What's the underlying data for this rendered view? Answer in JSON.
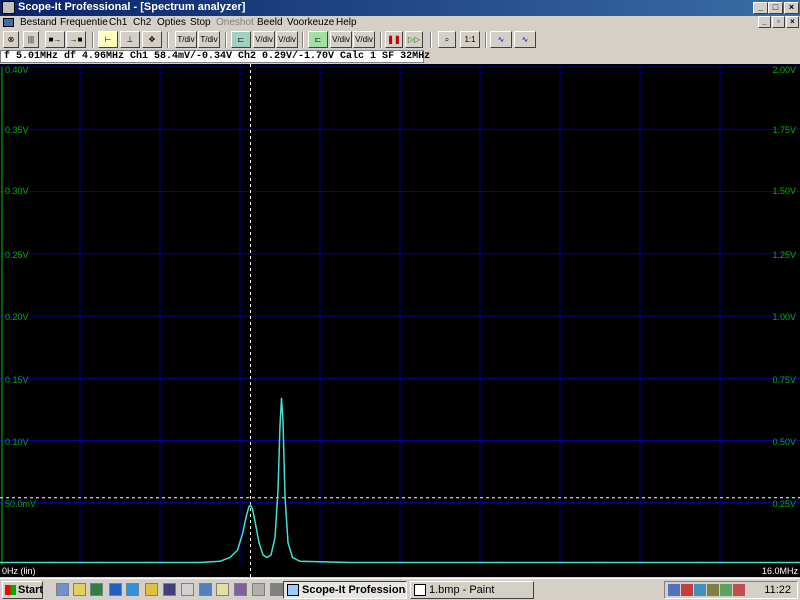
{
  "window": {
    "title": "Scope-It Professional - [Spectrum analyzer]"
  },
  "menu": {
    "items": [
      {
        "label": "Bestand",
        "enabled": true
      },
      {
        "label": "Frequentie",
        "enabled": true
      },
      {
        "label": "Ch1",
        "enabled": true
      },
      {
        "label": "Ch2",
        "enabled": true
      },
      {
        "label": "Opties",
        "enabled": true
      },
      {
        "label": "Stop",
        "enabled": true
      },
      {
        "label": "Oneshot",
        "enabled": false
      },
      {
        "label": "Beeld",
        "enabled": true
      },
      {
        "label": "Voorkeuze",
        "enabled": true
      },
      {
        "label": "Help",
        "enabled": true
      }
    ]
  },
  "toolbar": {
    "buttons": [
      {
        "icon": "record-icon",
        "glyph": "⊗"
      },
      {
        "icon": "bars-icon",
        "glyph": "|||"
      },
      {
        "icon": "ch1-arrow-icon",
        "glyph": "■→"
      },
      {
        "icon": "ch2-arrow-icon",
        "glyph": "→■"
      },
      {
        "icon": "cursor-left-icon",
        "glyph": "⊢"
      },
      {
        "icon": "cursor-mid-icon",
        "glyph": "⊥"
      },
      {
        "icon": "cursor-both-icon",
        "glyph": "✥"
      },
      {
        "icon": "time-per-div-down-icon",
        "glyph": "T/div"
      },
      {
        "icon": "time-per-div-up-icon",
        "glyph": "T/div"
      },
      {
        "icon": "ch1-position-icon",
        "glyph": "⊏"
      },
      {
        "icon": "ch1-volt-div-down-icon",
        "glyph": "V/div"
      },
      {
        "icon": "ch1-volt-div-up-icon",
        "glyph": "V/div"
      },
      {
        "icon": "ch2-position-icon",
        "glyph": "⊏"
      },
      {
        "icon": "ch2-volt-div-down-icon",
        "glyph": "V/div"
      },
      {
        "icon": "ch2-volt-div-up-icon",
        "glyph": "V/div"
      },
      {
        "icon": "pause-icon",
        "glyph": "❚❚"
      },
      {
        "icon": "play-icon",
        "glyph": "▷▷"
      },
      {
        "icon": "zoom-icon",
        "glyph": "⌕"
      },
      {
        "icon": "one-to-one-icon",
        "glyph": "1:1"
      },
      {
        "icon": "waveform-a-icon",
        "glyph": "∿"
      },
      {
        "icon": "waveform-b-icon",
        "glyph": "∿"
      }
    ]
  },
  "status": {
    "text": "f  5.01MHz df  4.96MHz Ch1   58.4mV/-0.34V Ch2   0.29V/-1.70V Calc   1 SF   32MHz"
  },
  "scope": {
    "left_axis": [
      "0.40V",
      "0.35V",
      "0.30V",
      "0.25V",
      "0.20V",
      "0.15V",
      "0.10V",
      "50.0mV"
    ],
    "right_axis": [
      "2.00V",
      "1.75V",
      "1.50V",
      "1.25V",
      "1.00V",
      "0.75V",
      "0.50V",
      "0.25V"
    ],
    "x_start": "0Hz (lin)",
    "x_end": "16.0MHz",
    "colors": {
      "background": "#000000",
      "grid": "#0000a0",
      "ch1_trace": "#40e0d0",
      "ch2_marker": "#00c000",
      "cursor": "#ffffff"
    }
  },
  "chart_data": {
    "type": "line",
    "xlabel": "",
    "ylabel": "",
    "x_range_mhz": [
      0,
      16
    ],
    "y_range_v": [
      0,
      0.4
    ],
    "cursor_frequency_mhz": 5.01,
    "cursor_level_v": 0.054,
    "series": [
      {
        "name": "Ch1",
        "points": [
          [
            0.0,
            0.002
          ],
          [
            0.5,
            0.002
          ],
          [
            1.0,
            0.002
          ],
          [
            2.0,
            0.002
          ],
          [
            3.0,
            0.002
          ],
          [
            4.0,
            0.002
          ],
          [
            4.4,
            0.003
          ],
          [
            4.6,
            0.006
          ],
          [
            4.75,
            0.012
          ],
          [
            4.85,
            0.025
          ],
          [
            4.93,
            0.04
          ],
          [
            4.98,
            0.047
          ],
          [
            5.01,
            0.048
          ],
          [
            5.05,
            0.045
          ],
          [
            5.1,
            0.035
          ],
          [
            5.18,
            0.018
          ],
          [
            5.26,
            0.008
          ],
          [
            5.34,
            0.006
          ],
          [
            5.42,
            0.008
          ],
          [
            5.5,
            0.022
          ],
          [
            5.56,
            0.06
          ],
          [
            5.6,
            0.112
          ],
          [
            5.63,
            0.134
          ],
          [
            5.66,
            0.115
          ],
          [
            5.7,
            0.055
          ],
          [
            5.76,
            0.018
          ],
          [
            5.85,
            0.006
          ],
          [
            6.0,
            0.003
          ],
          [
            7.0,
            0.002
          ],
          [
            8.0,
            0.002
          ],
          [
            10.0,
            0.002
          ],
          [
            12.0,
            0.002
          ],
          [
            14.0,
            0.002
          ],
          [
            16.0,
            0.002
          ]
        ]
      }
    ]
  },
  "taskbar": {
    "start_label": "Start",
    "quick_launch": [
      "save-icon",
      "email-icon",
      "desktop-icon",
      "ie-icon",
      "globe-icon",
      "media-icon",
      "folder-icon",
      "paint-icon",
      "user-icon",
      "docs-icon",
      "tools-icon",
      "settings-icon",
      "arrow-icon"
    ],
    "tasks": [
      {
        "label": "Scope-It Professional...",
        "active": true
      },
      {
        "label": "1.bmp - Paint",
        "active": false
      }
    ],
    "tray_icons": [
      "network-icon",
      "volume-icon",
      "display-icon",
      "pen-icon",
      "battery-icon",
      "shield-icon"
    ],
    "clock": "11:22"
  }
}
